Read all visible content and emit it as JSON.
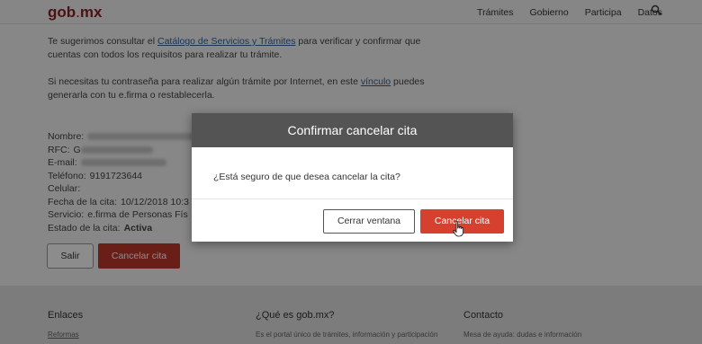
{
  "header": {
    "logo_main": "gob",
    "logo_dot": ".",
    "logo_tld": "mx",
    "nav": [
      "Trámites",
      "Gobierno",
      "Participa",
      "Datos"
    ]
  },
  "main": {
    "p1_before": "Te sugerimos consultar el ",
    "p1_link": "Catálogo de Servicios y Trámites",
    "p1_after": " para verificar y confirmar que cuentas con todos los requisitos para realizar tu trámite.",
    "p2_before": "Si necesitas tu contraseña para realizar algún trámite por Internet, en este ",
    "p2_link": "vínculo",
    "p2_after": " puedes generarla con tu e.firma o restablecerla.",
    "info": {
      "nombre_label": "Nombre:",
      "rfc_label": "RFC:",
      "rfc_value": "G",
      "email_label": "E-mail:",
      "telefono_label": "Teléfono:",
      "telefono_value": "9191723644",
      "celular_label": "Celular:",
      "fecha_label": "Fecha de la cita:",
      "fecha_value": "10/12/2018 10:3",
      "servicio_label": "Servicio:",
      "servicio_value": "e.firma de Personas Fís",
      "estado_label": "Estado de la cita:",
      "estado_value": "Activa"
    },
    "salir_label": "Salir",
    "cancel_label": "Cancelar cita"
  },
  "footer": {
    "col1_title": "Enlaces",
    "col1_text": "Reformas",
    "col2_title": "¿Qué es gob.mx?",
    "col2_text": "Es el portal único de trámites, información y participación",
    "col3_title": "Contacto",
    "col3_text": "Mesa de ayuda: dudas e información"
  },
  "modal": {
    "title": "Confirmar cancelar cita",
    "question": "¿Está seguro de que desea cancelar la cita?",
    "close_label": "Cerrar ventana",
    "confirm_label": "Cancelar cita"
  },
  "colors": {
    "brand": "#8f1f1f",
    "danger": "#d6402e",
    "modal_header": "#545454",
    "link": "#2d5f9e"
  }
}
